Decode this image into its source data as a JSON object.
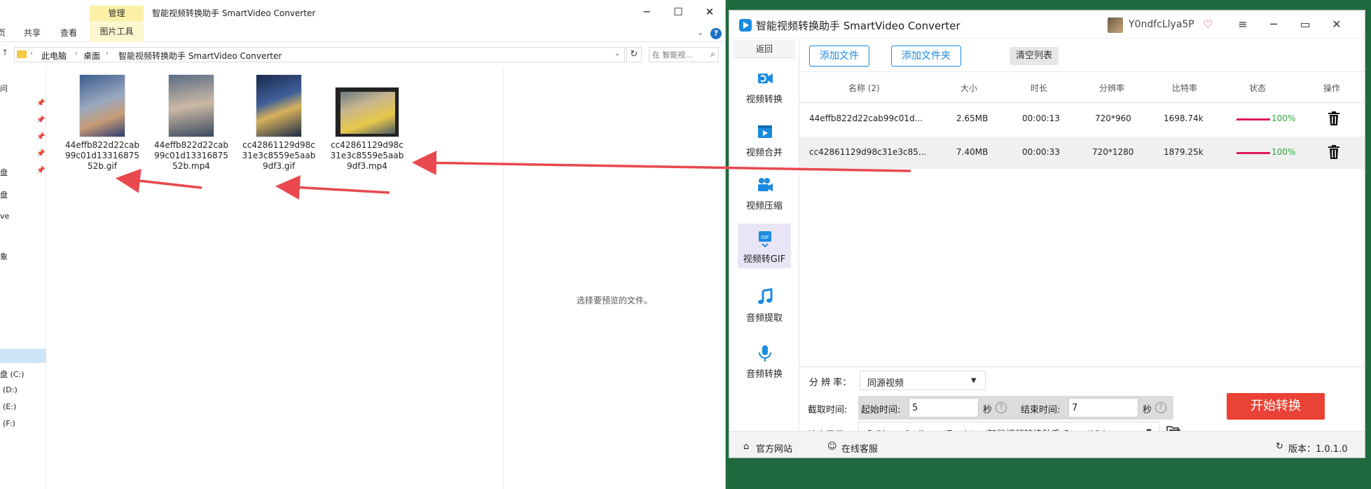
{
  "explorer": {
    "manage_tab": "管理",
    "title": "智能视频转换助手 SmartVideo Converter",
    "ribbon": {
      "tab_partial": "页",
      "share": "共享",
      "view": "查看",
      "picture_tools": "图片工具"
    },
    "address": {
      "crumbs": [
        "此电脑",
        "桌面",
        "智能视频转换助手 SmartVideo Converter"
      ],
      "search_placeholder": "在 智能视..."
    },
    "nav": [
      "问",
      "盘",
      "盘",
      "ve",
      "象",
      "盘 (C:)",
      "(D:)",
      "(E:)",
      "(F:)"
    ],
    "files": [
      {
        "name": "44effb822d22cab99c01d1331687552b.gif",
        "kind": "image"
      },
      {
        "name": "44effb822d22cab99c01d1331687552b.mp4",
        "kind": "video"
      },
      {
        "name": "cc42861129d98c31e3c8559e5aab9df3.gif",
        "kind": "image"
      },
      {
        "name": "cc42861129d98c31e3c8559e5aab9df3.mp4",
        "kind": "video"
      }
    ],
    "preview_text": "选择要预览的文件。"
  },
  "app": {
    "title": "智能视频转换助手 SmartVideo Converter",
    "username": "Y0ndfcLlya5P",
    "sidebar": {
      "back": "返回",
      "items": [
        {
          "label": "视频转换",
          "icon": "video-convert-icon"
        },
        {
          "label": "视频合并",
          "icon": "video-merge-icon"
        },
        {
          "label": "视频压缩",
          "icon": "video-compress-icon"
        },
        {
          "label": "视频转GIF",
          "icon": "gif-icon",
          "active": true
        },
        {
          "label": "音频提取",
          "icon": "music-note-icon"
        },
        {
          "label": "音频转换",
          "icon": "microphone-icon"
        }
      ]
    },
    "toolbar": {
      "add_file": "添加文件",
      "add_folder": "添加文件夹",
      "clear_list": "清空列表"
    },
    "table": {
      "headers": [
        "名称 (2)",
        "大小",
        "时长",
        "分辨率",
        "比特率",
        "状态",
        "操作"
      ],
      "rows": [
        {
          "name": "44effb822d22cab99c01d...",
          "size": "2.65MB",
          "duration": "00:00:13",
          "resolution": "720*960",
          "bitrate": "1698.74k",
          "progress": 100,
          "progress_text": "100%"
        },
        {
          "name": "cc42861129d98c31e3c85...",
          "size": "7.40MB",
          "duration": "00:00:33",
          "resolution": "720*1280",
          "bitrate": "1879.25k",
          "progress": 100,
          "progress_text": "100%"
        }
      ]
    },
    "settings": {
      "resolution_label": "分 辨 率：",
      "resolution_value": "同源视频",
      "clip_label": "截取时间:",
      "start_label": "起始时间:",
      "start_value": "5",
      "sec_unit": "秒",
      "end_label": "结束时间:",
      "end_value": "7",
      "output_label": "输出目录:",
      "output_value": "C:/Users/huibang/Desktop/智能视频转换助手 SmartVideo",
      "start_button": "开始转换"
    },
    "footer": {
      "website": "官方网站",
      "support": "在线客服",
      "version": "版本：1.0.1.0"
    }
  },
  "colors": {
    "accent": "#1b8be0",
    "start_button": "#ea4335",
    "progress": "#e0195d",
    "arrow": "#e8484e",
    "desktop": "#1f6b3f"
  }
}
